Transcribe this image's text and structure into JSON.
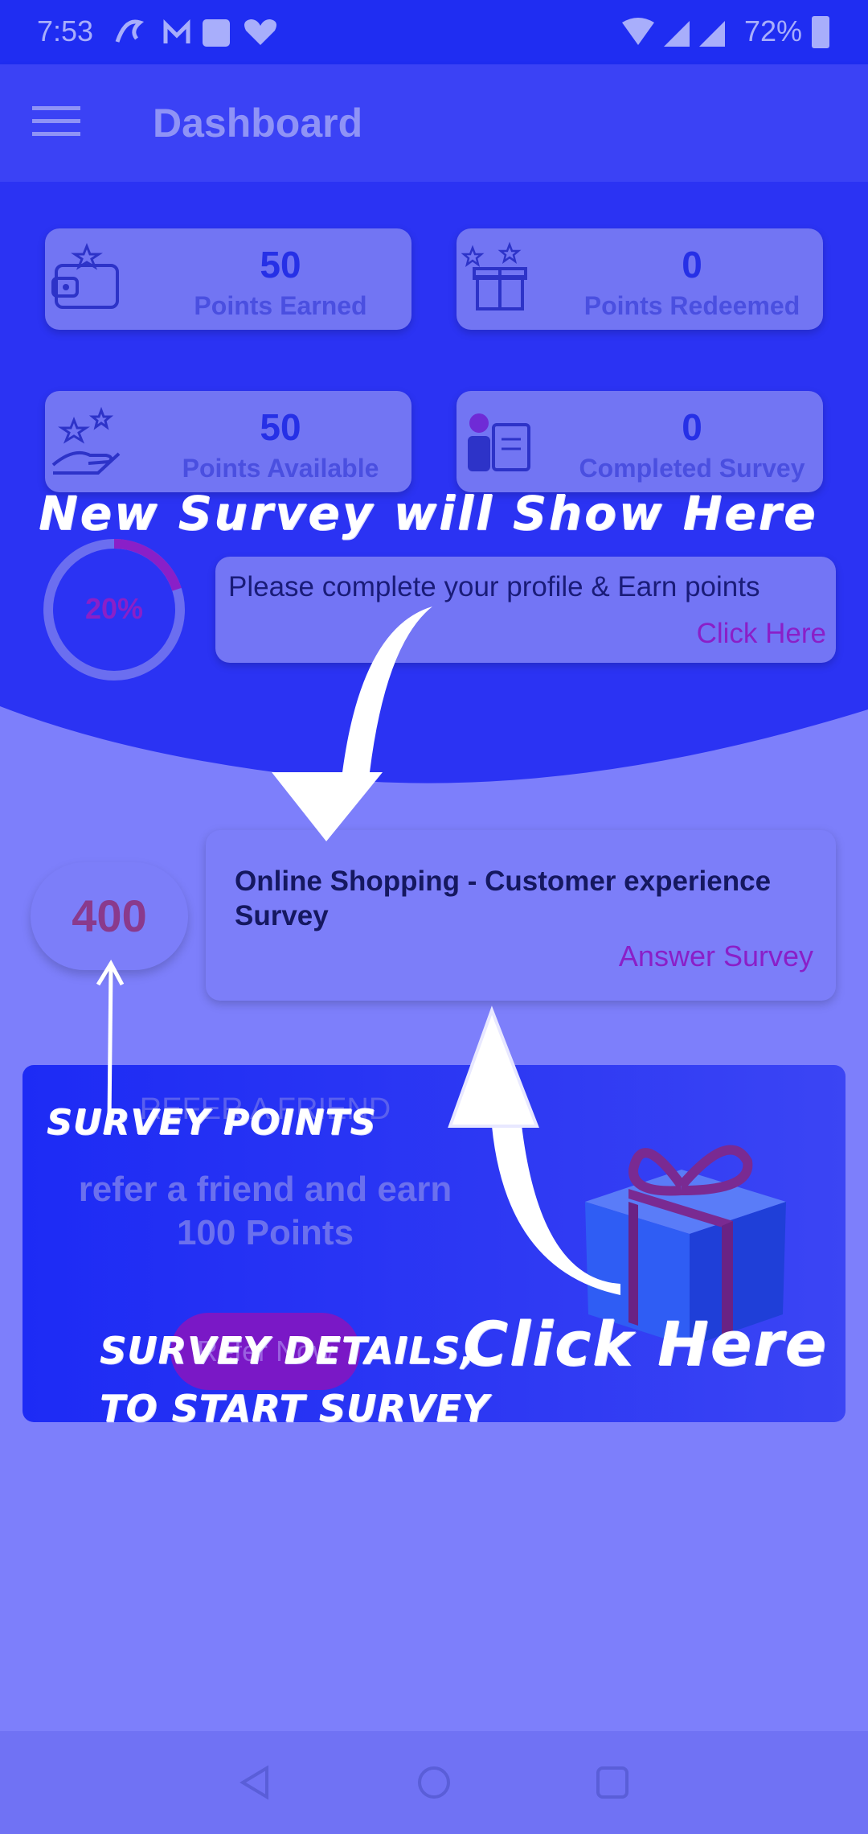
{
  "status_bar": {
    "time": "7:53",
    "battery": "72%"
  },
  "app_bar": {
    "title": "Dashboard"
  },
  "stats": [
    {
      "value": "50",
      "label": "Points Earned",
      "icon": "wallet-icon"
    },
    {
      "value": "0",
      "label": "Points Redeemed",
      "icon": "gift-box-icon"
    },
    {
      "value": "50",
      "label": "Points Available",
      "icon": "hand-stars-icon"
    },
    {
      "value": "0",
      "label": "Completed Survey",
      "icon": "survey-clipboard-icon"
    }
  ],
  "profile": {
    "progress_text": "20%",
    "progress": 0.2,
    "message": "Please complete your profile & Earn points",
    "link": "Click Here"
  },
  "survey": {
    "points": "400",
    "title": "Online Shopping - Customer experience Survey",
    "action": "Answer Survey"
  },
  "refer": {
    "heading": "REFER A FRIEND",
    "text_line1": "refer a friend and earn",
    "text_line2": "100 Points",
    "button": "Refer Now"
  },
  "annotations": {
    "new_survey": "New Survey will Show Here",
    "survey_points": "SURVEY POINTS",
    "details_line1": "SURVEY DETAILS,",
    "details_line2": "TO START SURVEY",
    "click_here": "Click Here"
  },
  "colors": {
    "primary": "#2b33f3",
    "light_bg": "#7d7ffb",
    "accent_purple": "#8a1fc8"
  }
}
